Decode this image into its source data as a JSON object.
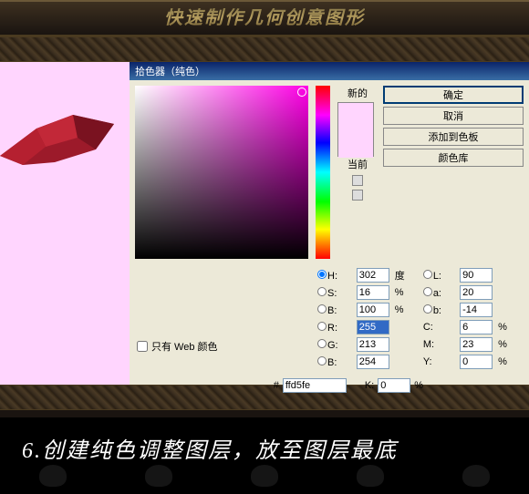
{
  "header": {
    "title": "快速制作几何创意图形"
  },
  "dialog": {
    "title": "拾色器（纯色）",
    "preview": {
      "new_label": "新的",
      "current_label": "当前"
    },
    "buttons": {
      "ok": "确定",
      "cancel": "取消",
      "add": "添加到色板",
      "lib": "颜色库"
    },
    "web_only": {
      "label": "只有 Web 颜色"
    },
    "hsb": {
      "h": "302",
      "h_unit": "度",
      "s": "16",
      "b": "100"
    },
    "lab": {
      "l": "90",
      "a": "20",
      "b": "-14"
    },
    "rgb": {
      "r": "255",
      "g": "213",
      "b": "254"
    },
    "cmyk": {
      "c": "6",
      "m": "23",
      "y": "0",
      "k": "0"
    },
    "pct": "%",
    "hex": {
      "prefix": "#",
      "value": "ffd5fe"
    }
  },
  "caption": {
    "text": "6.创建纯色调整图层，放至图层最底"
  }
}
